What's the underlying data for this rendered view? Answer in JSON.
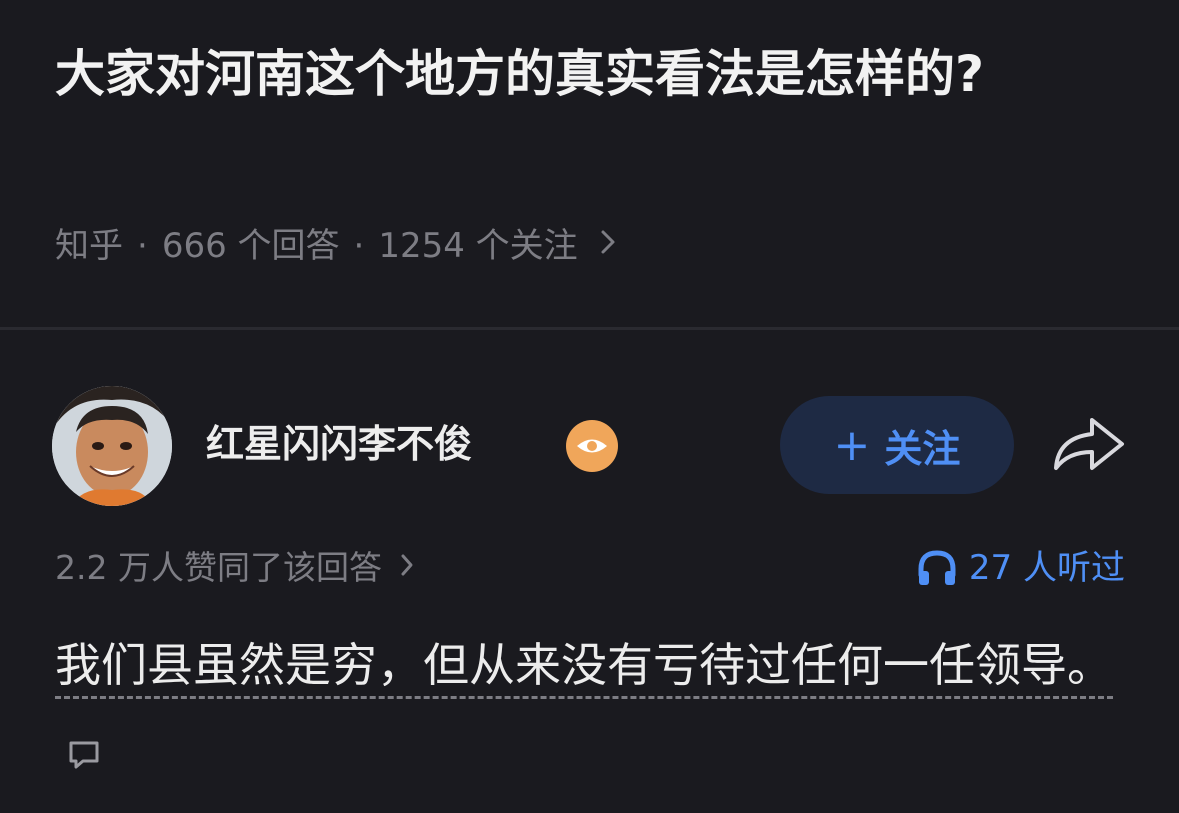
{
  "question": {
    "title": "大家对河南这个地方的真实看法是怎样的?",
    "source": "知乎",
    "answers": "666 个回答",
    "followers": "1254 个关注",
    "separator": "·"
  },
  "answer": {
    "author_name": "红星闪闪李不俊",
    "follow_label": "关注",
    "likes_text": "2.2 万人赞同了该回答",
    "listens_text": "27 人听过",
    "content": "我们县虽然是穷，但从来没有亏待过任何一任领导。"
  },
  "icons": {
    "badge": "eye-icon",
    "follow": "plus-icon",
    "share": "share-arrow-icon",
    "listens": "headphones-icon",
    "comment": "comment-bubble-icon",
    "chevron": "chevron-right-icon"
  },
  "colors": {
    "background": "#1a1a1f",
    "accent": "#4f8ff5",
    "muted": "#7d7d84",
    "badge": "#f0a65a",
    "follow_bg": "#1e2a44"
  }
}
